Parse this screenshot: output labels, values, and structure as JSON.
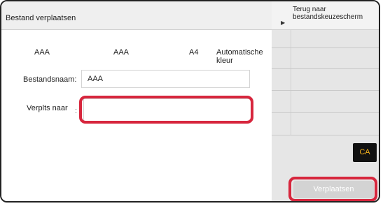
{
  "header": {
    "title": "Bestand verplaatsen"
  },
  "info": {
    "value1": "AAA",
    "value2": "AAA",
    "paper_size": "A4",
    "color_mode": "Automatische kleur"
  },
  "form": {
    "filename_label": "Bestandsnaam:",
    "filename_value": "AAA",
    "move_to_label": "Verplts naar",
    "move_to_colon": ":",
    "move_to_value": ""
  },
  "sidebar": {
    "back_line1": "Terug naar",
    "back_line2": "bestandskeuzescherm",
    "back_arrow_icon": "▶"
  },
  "buttons": {
    "ca_label": "CA",
    "move_label": "Verplaatsen"
  },
  "colors": {
    "highlight": "#d7263d",
    "ca_text": "#f5b21d",
    "ca_background": "#111111",
    "disabled_button": "#d3d3d3"
  }
}
